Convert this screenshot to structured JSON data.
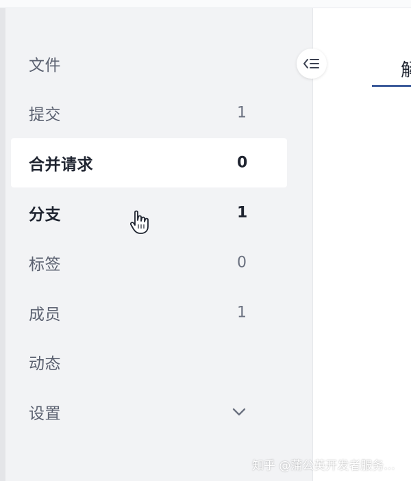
{
  "sidebar": {
    "items": [
      {
        "label": "文件",
        "count": ""
      },
      {
        "label": "提交",
        "count": "1"
      },
      {
        "label": "合并请求",
        "count": "0"
      },
      {
        "label": "分支",
        "count": "1"
      },
      {
        "label": "标签",
        "count": "0"
      },
      {
        "label": "成员",
        "count": "1"
      },
      {
        "label": "动态",
        "count": ""
      },
      {
        "label": "设置",
        "count": ""
      }
    ],
    "active_item": "合并请求",
    "expand_icon": "chevron-down-icon",
    "collapse_icon": "sidebar-collapse-icon"
  },
  "main": {
    "tab_label": "解"
  },
  "watermark": {
    "text": "知乎 @蒲公英开发者服务..."
  },
  "colors": {
    "sidebar_bg": "#f2f3f5",
    "active_bg": "#ffffff",
    "accent": "#3b5a9a",
    "text_muted": "#5b6170",
    "text_strong": "#1f2430"
  }
}
